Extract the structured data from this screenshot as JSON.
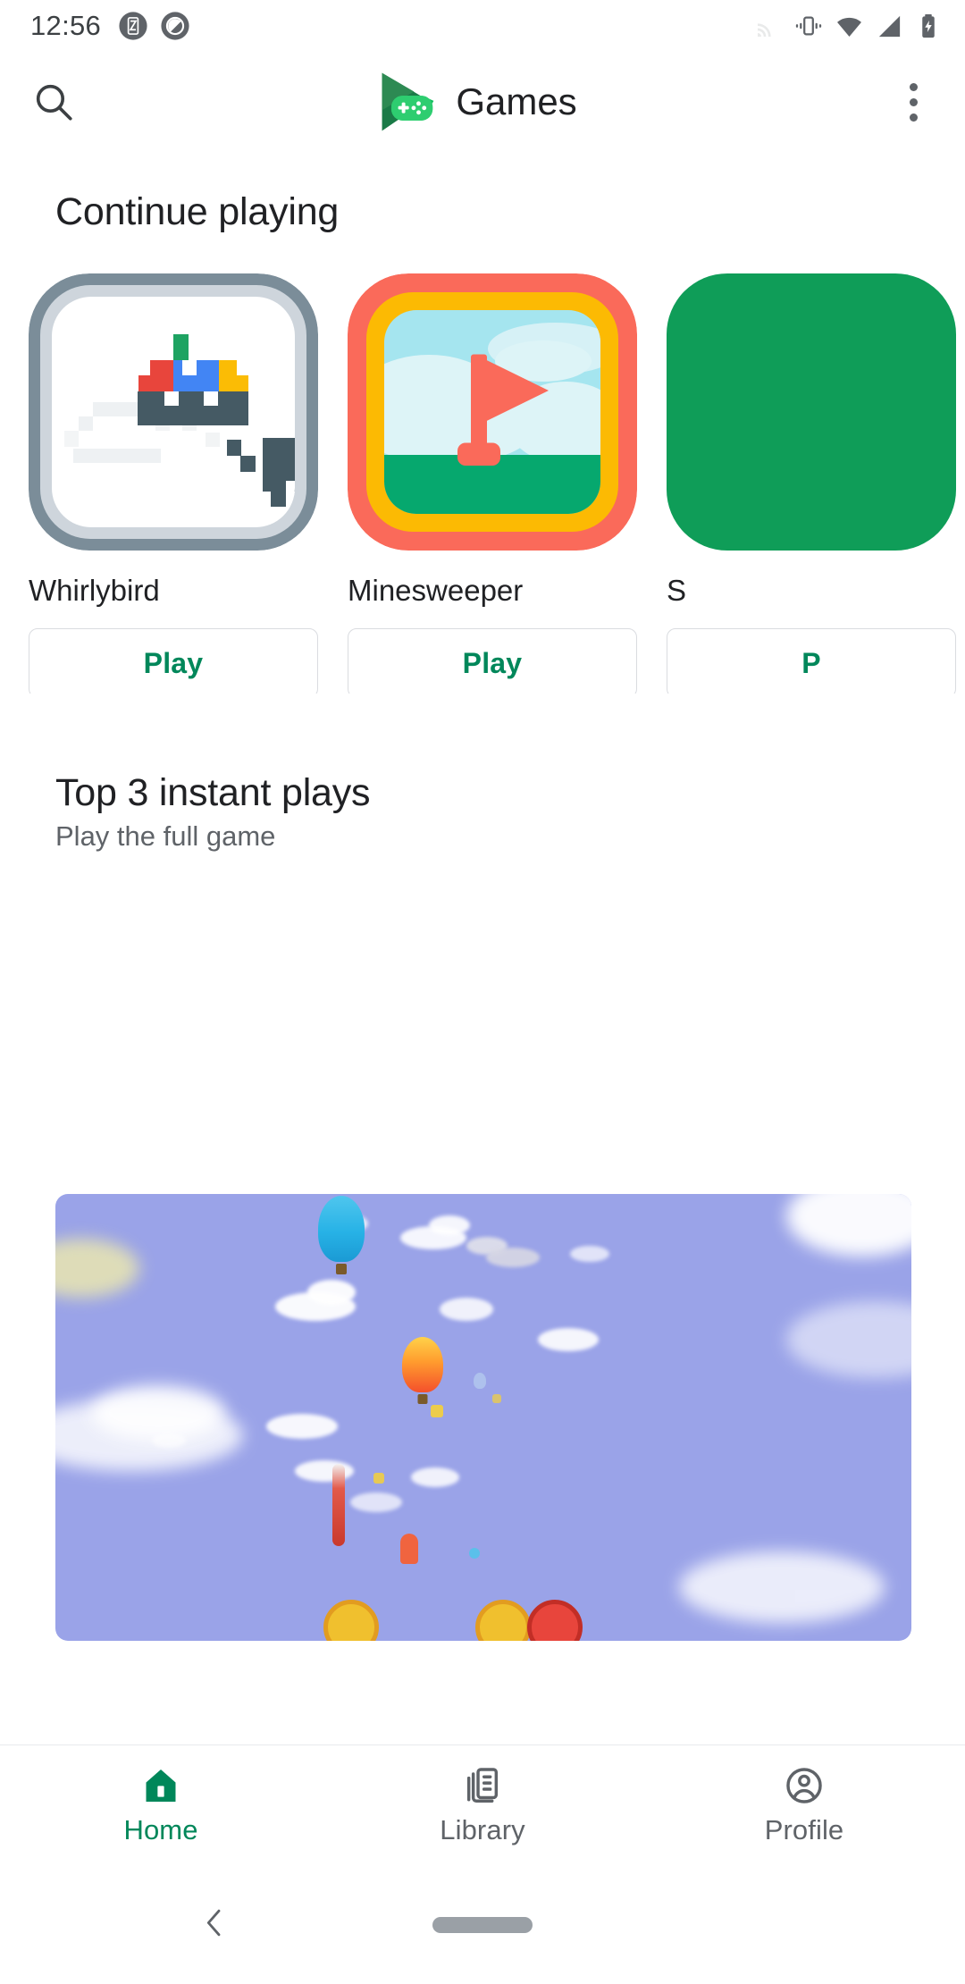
{
  "status_bar": {
    "time": "12:56",
    "left_icons": [
      "screenshot-icon",
      "do-not-disturb-icon"
    ],
    "right_icons": [
      "cast-icon",
      "vibrate-icon",
      "wifi-icon",
      "cellular-signal-icon",
      "battery-charging-icon"
    ]
  },
  "app_bar": {
    "search_icon": "search-icon",
    "logo_icon": "play-games-logo-icon",
    "title": "Games",
    "overflow_icon": "more-vert-icon"
  },
  "continue_playing": {
    "heading": "Continue playing",
    "games": [
      {
        "name": "Whirlybird",
        "play_label": "Play",
        "icon": "whirlybird-icon"
      },
      {
        "name": "Minesweeper",
        "play_label": "Play",
        "icon": "minesweeper-icon"
      },
      {
        "name": "S",
        "play_label": "P",
        "icon": "snake-icon"
      }
    ]
  },
  "instant_plays": {
    "heading": "Top 3 instant plays",
    "subheading": "Play the full game",
    "banner_alt": "game-screenshot-banner"
  },
  "bottom_nav": {
    "items": [
      {
        "label": "Home",
        "icon": "home-icon",
        "active": true
      },
      {
        "label": "Library",
        "icon": "library-icon",
        "active": false
      },
      {
        "label": "Profile",
        "icon": "profile-icon",
        "active": false
      }
    ]
  },
  "gesture_nav": {
    "back_icon": "back-chevron-icon",
    "home_pill_icon": "home-pill-icon"
  },
  "colors": {
    "accent_green": "#00875a",
    "logo_green_light": "#2fce7d",
    "logo_green_dark": "#1a7a47",
    "text_primary": "#202124",
    "text_secondary": "#5f6368",
    "minesweeper_coral": "#fa6a5a",
    "minesweeper_yellow": "#fcba03",
    "minesweeper_sky": "#a5e5ef",
    "minesweeper_grass": "#06a86e",
    "whirlybird_border": "#7b8d99",
    "whirlybird_border_inner": "#ced5dc",
    "pixel_dark": "#455a64",
    "banner_sky": "#9aa3e8"
  }
}
